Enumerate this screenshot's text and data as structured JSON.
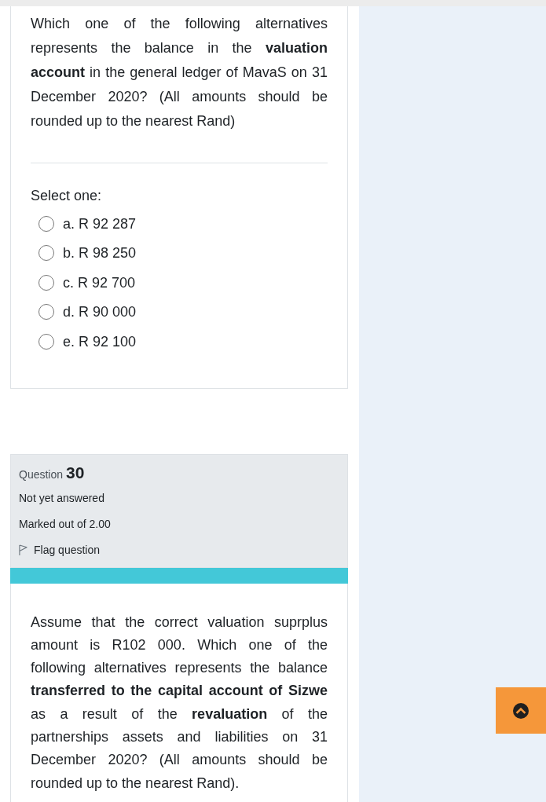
{
  "question_29": {
    "text": "Which one of the following alternatives represents the balance in the **valuation account** in the general ledger of MavaS on 31 December 2020? (All amounts should be rounded up to the nearest Rand)",
    "prompt": "Select one:",
    "options": [
      {
        "label": "a. R 92 287",
        "selected": false
      },
      {
        "label": "b. R 98 250",
        "selected": false
      },
      {
        "label": "c. R 92 700",
        "selected": false
      },
      {
        "label": "d. R 90 000",
        "selected": false
      },
      {
        "label": "e. R 92 100",
        "selected": false
      }
    ]
  },
  "question_30": {
    "label": "Question",
    "number": "30",
    "status": "Not yet answered",
    "marks": "Marked out of 2.00",
    "flag": {
      "label": "Flag question",
      "flagged": false
    },
    "text": "Assume that the correct valuation suprplus amount is R102 000.  Which one of the following alternatives represents the balance **transferred to the capital account of Sizwe** as a result of the **revaluation** of the partnerships assets and liabilities on 31 December 2020? (All amounts should be rounded up to the nearest Rand)."
  }
}
